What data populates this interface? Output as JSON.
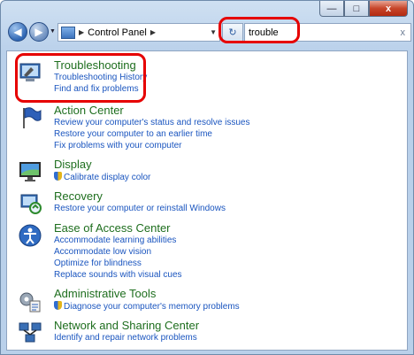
{
  "window": {
    "minimize": "—",
    "maximize": "□",
    "close": "x"
  },
  "toolbar": {
    "back": "◀",
    "forward": "▶",
    "nav_dropdown": "▼",
    "refresh": "↻"
  },
  "address": {
    "separator": "▶",
    "crumb": "Control Panel",
    "crumb_separator": "▶",
    "dropdown": "▼"
  },
  "search": {
    "value": "trouble",
    "clear": "x"
  },
  "results": [
    {
      "title": "Troubleshooting",
      "icon": "troubleshooting-icon",
      "links": [
        "Troubleshooting History",
        "Find and fix problems"
      ]
    },
    {
      "title": "Action Center",
      "icon": "action-center-flag-icon",
      "links": [
        "Review your computer's status and resolve issues",
        "Restore your computer to an earlier time",
        "Fix problems with your computer"
      ]
    },
    {
      "title": "Display",
      "icon": "display-monitor-icon",
      "links": [
        "Calibrate display color"
      ]
    },
    {
      "title": "Recovery",
      "icon": "recovery-icon",
      "links": [
        "Restore your computer or reinstall Windows"
      ]
    },
    {
      "title": "Ease of Access Center",
      "icon": "ease-of-access-icon",
      "links": [
        "Accommodate learning abilities",
        "Accommodate low vision",
        "Optimize for blindness",
        "Replace sounds with visual cues"
      ]
    },
    {
      "title": "Administrative Tools",
      "icon": "administrative-tools-icon",
      "links": [
        "Diagnose your computer's memory problems"
      ]
    },
    {
      "title": "Network and Sharing Center",
      "icon": "network-sharing-icon",
      "links": [
        "Identify and repair network problems"
      ]
    }
  ]
}
